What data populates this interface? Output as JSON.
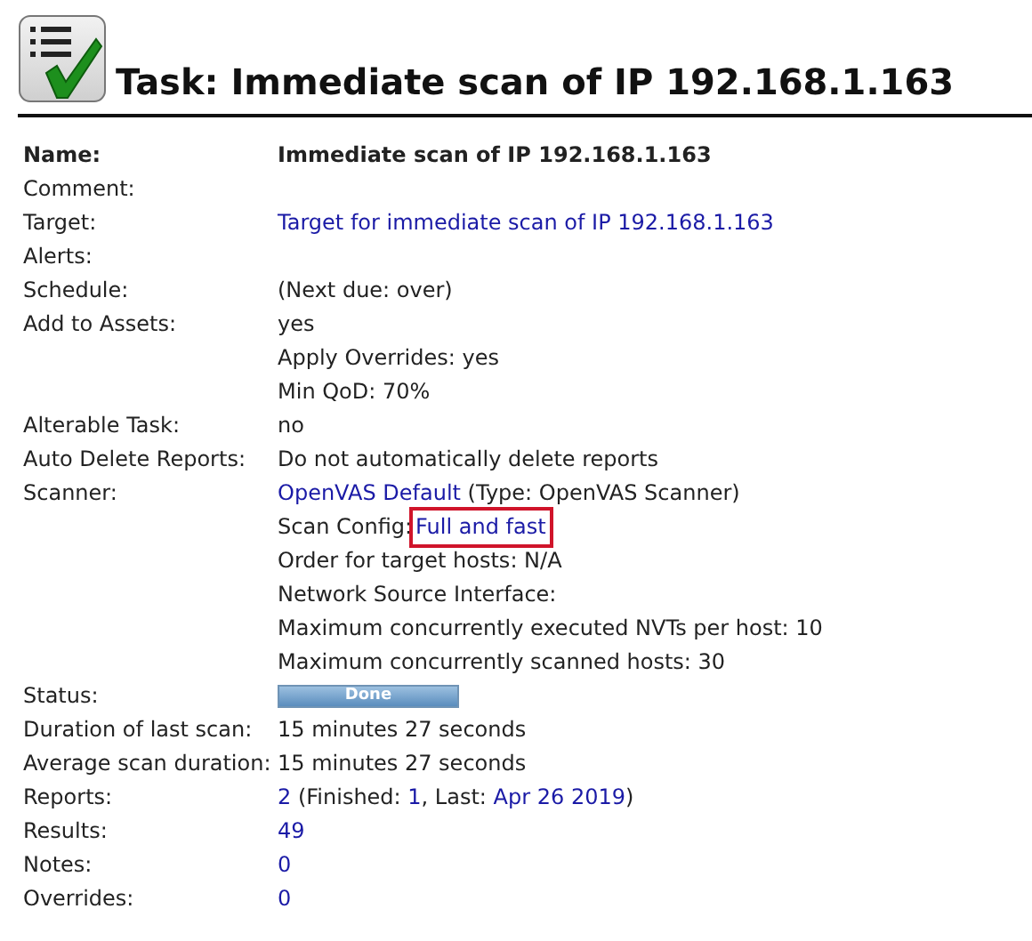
{
  "title": "Task: Immediate scan of IP 192.168.1.163",
  "rows": [
    {
      "label": "Name:",
      "bold": true,
      "lines": [
        [
          {
            "text": "Immediate scan of IP 192.168.1.163",
            "link": false,
            "highlighted": false
          }
        ]
      ]
    },
    {
      "label": "Comment:",
      "bold": false,
      "lines": []
    },
    {
      "label": "Target:",
      "bold": false,
      "lines": [
        [
          {
            "text": "Target for immediate scan of IP 192.168.1.163",
            "link": true,
            "highlighted": false
          }
        ]
      ]
    },
    {
      "label": "Alerts:",
      "bold": false,
      "lines": []
    },
    {
      "label": "Schedule:",
      "bold": false,
      "lines": [
        [
          {
            "text": "(Next due: over)",
            "link": false,
            "highlighted": false
          }
        ]
      ]
    },
    {
      "label": "Add to Assets:",
      "bold": false,
      "lines": [
        [
          {
            "text": "yes",
            "link": false,
            "highlighted": false
          }
        ],
        [
          {
            "text": "Apply Overrides: yes",
            "link": false,
            "highlighted": false
          }
        ],
        [
          {
            "text": "Min QoD: 70%",
            "link": false,
            "highlighted": false
          }
        ]
      ]
    },
    {
      "label": "Alterable Task:",
      "bold": false,
      "lines": [
        [
          {
            "text": "no",
            "link": false,
            "highlighted": false
          }
        ]
      ]
    },
    {
      "label": "Auto Delete Reports:",
      "bold": false,
      "lines": [
        [
          {
            "text": "Do not automatically delete reports",
            "link": false,
            "highlighted": false
          }
        ]
      ]
    },
    {
      "label": "Scanner:",
      "bold": false,
      "lines": [
        [
          {
            "text": "OpenVAS Default",
            "link": true,
            "highlighted": false
          },
          {
            "text": " (Type: OpenVAS Scanner)",
            "link": false,
            "highlighted": false
          }
        ],
        [
          {
            "text": "Scan Config:",
            "link": false,
            "highlighted": false
          },
          {
            "text": "Full and fast",
            "link": true,
            "highlighted": true
          }
        ],
        [
          {
            "text": "Order for target hosts: N/A",
            "link": false,
            "highlighted": false
          }
        ],
        [
          {
            "text": "Network Source Interface:",
            "link": false,
            "highlighted": false
          }
        ],
        [
          {
            "text": "Maximum concurrently executed NVTs per host: 10",
            "link": false,
            "highlighted": false
          }
        ],
        [
          {
            "text": "Maximum concurrently scanned hosts: 30",
            "link": false,
            "highlighted": false
          }
        ]
      ]
    },
    {
      "label": "Status:",
      "bold": false,
      "status": {
        "text": "Done",
        "level": 1
      },
      "lines": []
    },
    {
      "label": "Duration of last scan:",
      "bold": false,
      "lines": [
        [
          {
            "text": "15 minutes 27 seconds",
            "link": false,
            "highlighted": false
          }
        ]
      ]
    },
    {
      "label": "Average scan duration:",
      "bold": false,
      "lines": [
        [
          {
            "text": "15 minutes 27 seconds",
            "link": false,
            "highlighted": false
          }
        ]
      ]
    },
    {
      "label": "Reports:",
      "bold": false,
      "lines": [
        [
          {
            "text": "2",
            "link": true,
            "highlighted": false
          },
          {
            "text": " (Finished: ",
            "link": false,
            "highlighted": false
          },
          {
            "text": "1",
            "link": true,
            "highlighted": false
          },
          {
            "text": ", Last: ",
            "link": false,
            "highlighted": false
          },
          {
            "text": "Apr 26 2019",
            "link": true,
            "highlighted": false
          },
          {
            "text": ")",
            "link": false,
            "highlighted": false
          }
        ]
      ]
    },
    {
      "label": "Results:",
      "bold": false,
      "lines": [
        [
          {
            "text": "49",
            "link": true,
            "highlighted": false
          }
        ]
      ]
    },
    {
      "label": "Notes:",
      "bold": false,
      "lines": [
        [
          {
            "text": "0",
            "link": true,
            "highlighted": false
          }
        ]
      ]
    },
    {
      "label": "Overrides:",
      "bold": false,
      "lines": [
        [
          {
            "text": "0",
            "link": true,
            "highlighted": false
          }
        ]
      ]
    }
  ]
}
